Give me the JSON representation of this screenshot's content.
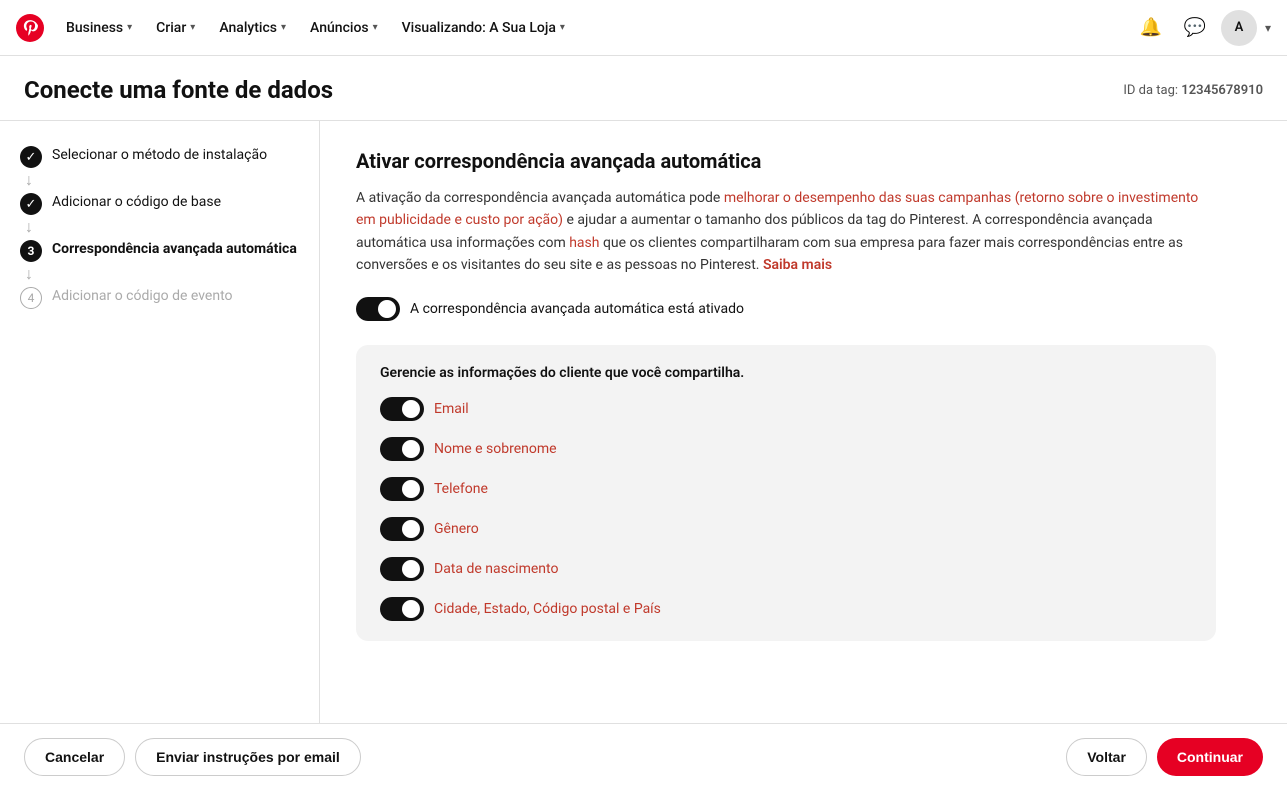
{
  "nav": {
    "business_label": "Business",
    "criar_label": "Criar",
    "analytics_label": "Analytics",
    "anuncios_label": "Anúncios",
    "visualizando_label": "Visualizando: A Sua Loja",
    "avatar_label": "A"
  },
  "page": {
    "title": "Conecte uma fonte de dados",
    "tag_id_label": "ID da tag:",
    "tag_id_value": "12345678910"
  },
  "sidebar": {
    "steps": [
      {
        "id": 1,
        "type": "done",
        "label": "Selecionar o método de instalação"
      },
      {
        "id": 2,
        "type": "done",
        "label": "Adicionar o código de base"
      },
      {
        "id": 3,
        "type": "active",
        "label": "Correspondência avançada automática"
      },
      {
        "id": 4,
        "type": "pending",
        "label": "Adicionar o código de evento"
      }
    ]
  },
  "main": {
    "section_title": "Ativar correspondência avançada automática",
    "description_part1": "A ativação da correspondência avançada automática pode ",
    "description_link1": "melhorar o desempenho das suas campanhas (retorno sobre o investimento em publicidade e custo por ação)",
    "description_part2": " e ajudar a aumentar o tamanho dos públicos da tag do Pinterest. A correspondência avançada automática usa informações com ",
    "description_link2": "hash",
    "description_part3": " que os clientes compartilharam com sua empresa para fazer mais correspondências entre as conversões e os visitantes do seu site e as pessoas no Pinterest. ",
    "saiba_mais": "Saiba mais",
    "main_toggle_label": "A correspondência avançada automática está ativado",
    "manage_box_title": "Gerencie as informações do cliente que você compartilha.",
    "options": [
      {
        "id": "email",
        "label": "Email",
        "on": true
      },
      {
        "id": "nome",
        "label": "Nome e sobrenome",
        "on": true
      },
      {
        "id": "telefone",
        "label": "Telefone",
        "on": true
      },
      {
        "id": "genero",
        "label": "Gênero",
        "on": true
      },
      {
        "id": "nascimento",
        "label": "Data de nascimento",
        "on": true
      },
      {
        "id": "cidade",
        "label": "Cidade, Estado, Código postal e País",
        "on": true
      }
    ]
  },
  "footer": {
    "cancel_label": "Cancelar",
    "send_email_label": "Enviar instruções por email",
    "back_label": "Voltar",
    "continue_label": "Continuar"
  }
}
